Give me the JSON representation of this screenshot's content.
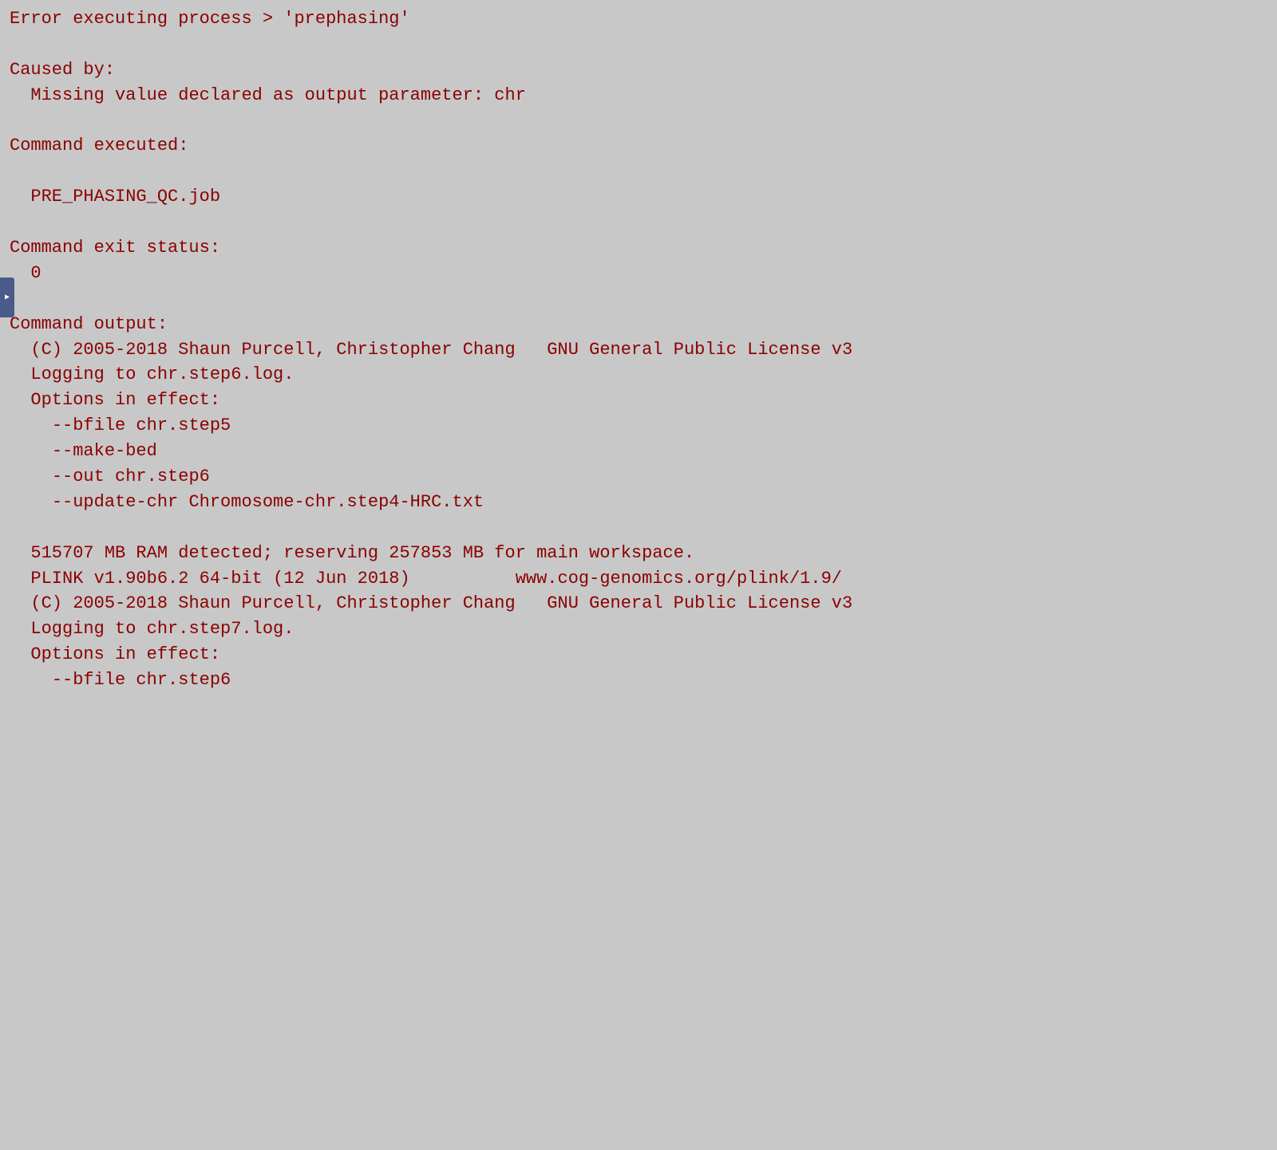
{
  "terminal": {
    "lines": [
      {
        "id": "error-line",
        "text": "Error executing process > 'prephasing'"
      },
      {
        "id": "blank1",
        "text": ""
      },
      {
        "id": "caused-by-label",
        "text": "Caused by:"
      },
      {
        "id": "caused-by-detail",
        "text": "  Missing value declared as output parameter: chr"
      },
      {
        "id": "blank2",
        "text": ""
      },
      {
        "id": "command-executed-label",
        "text": "Command executed:"
      },
      {
        "id": "blank3",
        "text": ""
      },
      {
        "id": "command-executed-value",
        "text": "  PRE_PHASING_QC.job"
      },
      {
        "id": "blank4",
        "text": ""
      },
      {
        "id": "command-exit-label",
        "text": "Command exit status:"
      },
      {
        "id": "command-exit-value",
        "text": "  0"
      },
      {
        "id": "blank5",
        "text": ""
      },
      {
        "id": "command-output-label",
        "text": "Command output:"
      },
      {
        "id": "plink-copyright1",
        "text": "  (C) 2005-2018 Shaun Purcell, Christopher Chang   GNU General Public License v3"
      },
      {
        "id": "logging-step6",
        "text": "  Logging to chr.step6.log."
      },
      {
        "id": "options-in-effect1",
        "text": "  Options in effect:"
      },
      {
        "id": "bfile-step5",
        "text": "    --bfile chr.step5"
      },
      {
        "id": "make-bed",
        "text": "    --make-bed"
      },
      {
        "id": "out-step6",
        "text": "    --out chr.step6"
      },
      {
        "id": "update-chr",
        "text": "    --update-chr Chromosome-chr.step4-HRC.txt"
      },
      {
        "id": "blank6",
        "text": ""
      },
      {
        "id": "ram-detected",
        "text": "  515707 MB RAM detected; reserving 257853 MB for main workspace."
      },
      {
        "id": "plink-version",
        "text": "  PLINK v1.90b6.2 64-bit (12 Jun 2018)          www.cog-genomics.org/plink/1.9/"
      },
      {
        "id": "plink-copyright2",
        "text": "  (C) 2005-2018 Shaun Purcell, Christopher Chang   GNU General Public License v3"
      },
      {
        "id": "logging-step7",
        "text": "  Logging to chr.step7.log."
      },
      {
        "id": "options-in-effect2",
        "text": "  Options in effect:"
      },
      {
        "id": "bfile-step6",
        "text": "    --bfile chr.step6"
      }
    ]
  },
  "sidebar": {
    "toggle_label": "▶"
  }
}
